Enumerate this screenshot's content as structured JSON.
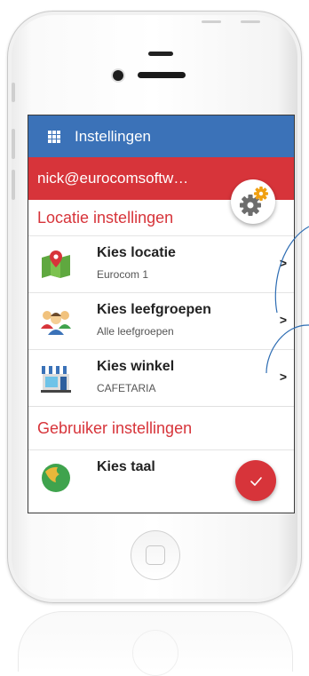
{
  "appbar": {
    "title": "Instellingen",
    "menu_icon": "grid-icon"
  },
  "user": {
    "email": "nick@eurocomsoftw…"
  },
  "settings_button": {
    "icon": "settings-gear-icon"
  },
  "sections": {
    "location": {
      "title": "Locatie instellingen"
    },
    "user": {
      "title": "Gebruiker instellingen"
    }
  },
  "rows": [
    {
      "title": "Kies locatie",
      "subtitle": "Eurocom 1",
      "icon": "map-pin-icon"
    },
    {
      "title": "Kies leefgroepen",
      "subtitle": "Alle leefgroepen",
      "icon": "group-icon"
    },
    {
      "title": "Kies winkel",
      "subtitle": "CAFETARIA",
      "icon": "store-icon"
    },
    {
      "title": "Kies taal",
      "icon": "globe-icon"
    }
  ],
  "chevron": ">",
  "fab": {
    "icon": "check-icon"
  },
  "colors": {
    "primary_blue": "#3b72b8",
    "accent_red": "#d7343a"
  }
}
